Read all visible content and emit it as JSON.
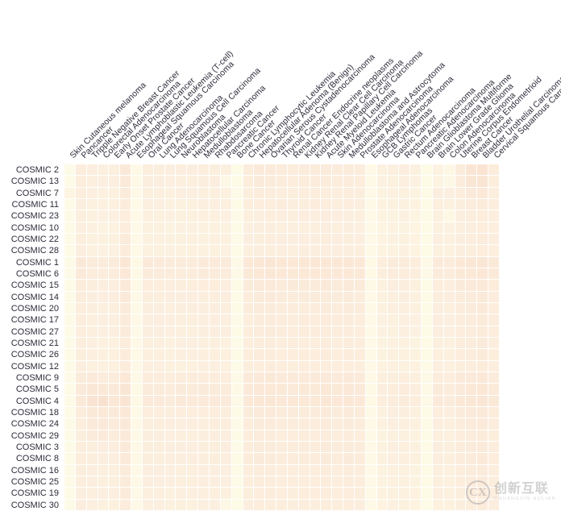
{
  "figure": {
    "type": "heatmap",
    "title": "",
    "watermark": {
      "logo_letter": "CX",
      "cn": "创新互联",
      "pinyin": "CHUANGXIN HULIAN"
    }
  },
  "chart_data": {
    "type": "heatmap",
    "title": "",
    "xlabel": "",
    "ylabel": "",
    "grid": true,
    "legend": "none",
    "colormap": {
      "low": "#fdfbe8",
      "mid": "#f8e2d2",
      "high": "#e8a896"
    },
    "x_tick_labels": [
      "Skin Cutaneous melanoma",
      "Pancancer",
      "Tripple Negative Breast Cancer",
      "Colorectal Adenocarcinoma",
      "Early Onset Prostate Cancer",
      "Acute Lymphoblastic Leukemia (T-cell)",
      "Esophageal Squamous Carcinoma",
      "Oral Cancer",
      "Lung Adenocarcinoma",
      "Lung Squamous Cell Carcinoma",
      "Neuroblastoma",
      "Hepatocellular Carcinoma",
      "Medulloblastoma",
      "Rhabdosarcoma",
      "Pancreatic Cancer",
      "Bone Cancer",
      "Chronic Lymphocytic Leukemia",
      "Hepatocellular Adenoma (Benign)",
      "Ovarian Serous Cystadenocarcinoma",
      "Thyroid Cancer",
      "Renal Cancer Endocrine neoplasms",
      "Kidney Renal Clear Cell Carcinoma",
      "Kidney Renal Papillary Cell Carcinoma",
      "Acute Myeloid Leukemia",
      "Skin Adenocarcinoma",
      "Medulloblastoma and Astrocytoma",
      "Prostate Adenocarcinoma",
      "Esophageal Adenocarcinoma",
      "GCB Lymphomas",
      "Gastric Cancer",
      "Rectum Adenocarcinoma",
      "Pancreatic Adenocarcinoma",
      "Brain Glioblastoma Multiforme",
      "Brain Lower Grade Glioma",
      "Colon Adenocarcinoma",
      "Uterine Corpus Endometrioid",
      "Breast Cancer",
      "Bladder Urothelial Carcinoma",
      "Cervical Squamous Carcinoma"
    ],
    "y_tick_labels": [
      "COSMIC 2",
      "COSMIC 13",
      "COSMIC 7",
      "COSMIC 11",
      "COSMIC 23",
      "COSMIC 10",
      "COSMIC 22",
      "COSMIC 28",
      "COSMIC 1",
      "COSMIC 6",
      "COSMIC 15",
      "COSMIC 14",
      "COSMIC 20",
      "COSMIC 17",
      "COSMIC 27",
      "COSMIC 21",
      "COSMIC 26",
      "COSMIC 12",
      "COSMIC 9",
      "COSMIC 5",
      "COSMIC 4",
      "COSMIC 18",
      "COSMIC 24",
      "COSMIC 29",
      "COSMIC 3",
      "COSMIC 8",
      "COSMIC 16",
      "COSMIC 25",
      "COSMIC 19",
      "COSMIC 30"
    ],
    "values": [
      [
        0.02,
        0.4,
        0.34,
        0.33,
        0.33,
        0.46,
        0.08,
        0.36,
        0.36,
        0.34,
        0.35,
        0.34,
        0.36,
        0.36,
        0.33,
        0.05,
        0.4,
        0.43,
        0.44,
        0.42,
        0.4,
        0.41,
        0.41,
        0.42,
        0.41,
        0.42,
        0.4,
        0.07,
        0.3,
        0.33,
        0.34,
        0.3,
        0.05,
        0.26,
        0.12,
        0.42,
        0.55,
        0.56,
        0.4
      ],
      [
        0.02,
        0.38,
        0.33,
        0.32,
        0.32,
        0.44,
        0.07,
        0.34,
        0.34,
        0.32,
        0.33,
        0.33,
        0.35,
        0.34,
        0.1,
        0.05,
        0.38,
        0.41,
        0.42,
        0.4,
        0.38,
        0.39,
        0.39,
        0.4,
        0.39,
        0.4,
        0.38,
        0.07,
        0.28,
        0.31,
        0.32,
        0.28,
        0.05,
        0.24,
        0.1,
        0.4,
        0.52,
        0.54,
        0.38
      ],
      [
        0.22,
        0.36,
        0.32,
        0.31,
        0.31,
        0.42,
        0.07,
        0.33,
        0.33,
        0.31,
        0.32,
        0.32,
        0.33,
        0.33,
        0.31,
        0.05,
        0.36,
        0.39,
        0.4,
        0.38,
        0.36,
        0.37,
        0.37,
        0.38,
        0.37,
        0.38,
        0.36,
        0.07,
        0.27,
        0.3,
        0.31,
        0.27,
        0.05,
        0.34,
        0.32,
        0.38,
        0.45,
        0.47,
        0.36
      ],
      [
        0.02,
        0.35,
        0.31,
        0.3,
        0.3,
        0.4,
        0.07,
        0.32,
        0.32,
        0.3,
        0.31,
        0.31,
        0.32,
        0.32,
        0.3,
        0.05,
        0.38,
        0.37,
        0.38,
        0.4,
        0.35,
        0.36,
        0.4,
        0.37,
        0.36,
        0.37,
        0.35,
        0.07,
        0.26,
        0.29,
        0.3,
        0.26,
        0.05,
        0.33,
        0.31,
        0.36,
        0.4,
        0.42,
        0.35
      ],
      [
        0.02,
        0.33,
        0.29,
        0.28,
        0.28,
        0.38,
        0.06,
        0.3,
        0.3,
        0.28,
        0.29,
        0.29,
        0.3,
        0.3,
        0.28,
        0.05,
        0.33,
        0.35,
        0.36,
        0.34,
        0.33,
        0.34,
        0.34,
        0.35,
        0.34,
        0.35,
        0.33,
        0.06,
        0.24,
        0.27,
        0.28,
        0.24,
        0.05,
        0.31,
        0.12,
        0.34,
        0.36,
        0.38,
        0.33
      ],
      [
        0.02,
        0.32,
        0.28,
        0.27,
        0.27,
        0.37,
        0.06,
        0.29,
        0.29,
        0.27,
        0.28,
        0.28,
        0.29,
        0.29,
        0.27,
        0.05,
        0.32,
        0.34,
        0.35,
        0.33,
        0.32,
        0.33,
        0.33,
        0.34,
        0.33,
        0.34,
        0.32,
        0.06,
        0.23,
        0.26,
        0.27,
        0.23,
        0.05,
        0.3,
        0.28,
        0.33,
        0.35,
        0.37,
        0.32
      ],
      [
        0.02,
        0.36,
        0.3,
        0.29,
        0.29,
        0.42,
        0.06,
        0.31,
        0.31,
        0.29,
        0.3,
        0.3,
        0.31,
        0.31,
        0.29,
        0.05,
        0.34,
        0.36,
        0.37,
        0.35,
        0.34,
        0.35,
        0.35,
        0.36,
        0.35,
        0.36,
        0.34,
        0.06,
        0.25,
        0.28,
        0.29,
        0.25,
        0.05,
        0.32,
        0.3,
        0.35,
        0.37,
        0.39,
        0.34
      ],
      [
        0.02,
        0.34,
        0.29,
        0.28,
        0.28,
        0.4,
        0.06,
        0.3,
        0.3,
        0.28,
        0.29,
        0.29,
        0.3,
        0.3,
        0.28,
        0.05,
        0.33,
        0.35,
        0.36,
        0.34,
        0.33,
        0.34,
        0.34,
        0.35,
        0.34,
        0.35,
        0.33,
        0.06,
        0.24,
        0.27,
        0.28,
        0.24,
        0.05,
        0.31,
        0.29,
        0.34,
        0.36,
        0.38,
        0.33
      ],
      [
        0.02,
        0.46,
        0.42,
        0.41,
        0.41,
        0.5,
        0.08,
        0.43,
        0.43,
        0.41,
        0.42,
        0.42,
        0.43,
        0.43,
        0.41,
        0.06,
        0.48,
        0.5,
        0.52,
        0.5,
        0.48,
        0.49,
        0.49,
        0.5,
        0.49,
        0.5,
        0.48,
        0.08,
        0.38,
        0.41,
        0.42,
        0.38,
        0.06,
        0.44,
        0.42,
        0.48,
        0.5,
        0.52,
        0.46
      ],
      [
        0.02,
        0.44,
        0.4,
        0.39,
        0.39,
        0.48,
        0.08,
        0.41,
        0.41,
        0.39,
        0.4,
        0.4,
        0.41,
        0.41,
        0.39,
        0.06,
        0.46,
        0.48,
        0.5,
        0.48,
        0.46,
        0.47,
        0.47,
        0.48,
        0.47,
        0.48,
        0.46,
        0.08,
        0.36,
        0.39,
        0.4,
        0.36,
        0.06,
        0.42,
        0.4,
        0.46,
        0.48,
        0.5,
        0.44
      ],
      [
        0.02,
        0.4,
        0.36,
        0.35,
        0.35,
        0.44,
        0.07,
        0.37,
        0.37,
        0.35,
        0.36,
        0.36,
        0.37,
        0.37,
        0.35,
        0.05,
        0.41,
        0.43,
        0.44,
        0.42,
        0.41,
        0.42,
        0.42,
        0.43,
        0.42,
        0.43,
        0.41,
        0.07,
        0.31,
        0.34,
        0.35,
        0.31,
        0.05,
        0.37,
        0.35,
        0.41,
        0.43,
        0.45,
        0.4
      ],
      [
        0.02,
        0.39,
        0.35,
        0.34,
        0.34,
        0.43,
        0.07,
        0.36,
        0.36,
        0.34,
        0.35,
        0.35,
        0.36,
        0.36,
        0.34,
        0.05,
        0.4,
        0.42,
        0.43,
        0.41,
        0.4,
        0.41,
        0.41,
        0.42,
        0.41,
        0.42,
        0.4,
        0.07,
        0.3,
        0.33,
        0.34,
        0.3,
        0.05,
        0.36,
        0.34,
        0.4,
        0.42,
        0.44,
        0.39
      ],
      [
        0.02,
        0.38,
        0.34,
        0.33,
        0.33,
        0.42,
        0.07,
        0.35,
        0.35,
        0.33,
        0.34,
        0.34,
        0.35,
        0.35,
        0.33,
        0.05,
        0.39,
        0.41,
        0.42,
        0.4,
        0.39,
        0.4,
        0.4,
        0.41,
        0.4,
        0.41,
        0.39,
        0.07,
        0.29,
        0.32,
        0.33,
        0.29,
        0.05,
        0.35,
        0.33,
        0.39,
        0.41,
        0.43,
        0.38
      ],
      [
        0.02,
        0.37,
        0.33,
        0.32,
        0.32,
        0.41,
        0.07,
        0.34,
        0.34,
        0.32,
        0.33,
        0.33,
        0.34,
        0.34,
        0.32,
        0.05,
        0.38,
        0.4,
        0.41,
        0.39,
        0.38,
        0.39,
        0.39,
        0.4,
        0.39,
        0.4,
        0.38,
        0.07,
        0.28,
        0.31,
        0.32,
        0.28,
        0.05,
        0.34,
        0.32,
        0.38,
        0.4,
        0.42,
        0.37
      ],
      [
        0.02,
        0.37,
        0.33,
        0.32,
        0.32,
        0.41,
        0.07,
        0.34,
        0.34,
        0.32,
        0.33,
        0.33,
        0.34,
        0.34,
        0.32,
        0.05,
        0.38,
        0.4,
        0.41,
        0.39,
        0.38,
        0.39,
        0.39,
        0.4,
        0.39,
        0.4,
        0.38,
        0.07,
        0.28,
        0.31,
        0.32,
        0.28,
        0.05,
        0.34,
        0.32,
        0.38,
        0.4,
        0.42,
        0.37
      ],
      [
        0.02,
        0.36,
        0.32,
        0.31,
        0.31,
        0.4,
        0.07,
        0.33,
        0.33,
        0.31,
        0.32,
        0.32,
        0.33,
        0.33,
        0.31,
        0.05,
        0.37,
        0.39,
        0.4,
        0.38,
        0.37,
        0.38,
        0.38,
        0.39,
        0.38,
        0.39,
        0.37,
        0.07,
        0.27,
        0.3,
        0.31,
        0.27,
        0.05,
        0.33,
        0.31,
        0.37,
        0.39,
        0.41,
        0.36
      ],
      [
        0.02,
        0.36,
        0.32,
        0.31,
        0.31,
        0.4,
        0.07,
        0.33,
        0.33,
        0.31,
        0.32,
        0.32,
        0.33,
        0.33,
        0.31,
        0.05,
        0.37,
        0.39,
        0.4,
        0.38,
        0.37,
        0.38,
        0.38,
        0.39,
        0.38,
        0.39,
        0.37,
        0.07,
        0.27,
        0.3,
        0.31,
        0.27,
        0.05,
        0.33,
        0.31,
        0.37,
        0.39,
        0.41,
        0.36
      ],
      [
        0.02,
        0.35,
        0.31,
        0.3,
        0.3,
        0.39,
        0.06,
        0.32,
        0.32,
        0.3,
        0.31,
        0.31,
        0.32,
        0.32,
        0.3,
        0.05,
        0.36,
        0.38,
        0.39,
        0.37,
        0.36,
        0.37,
        0.37,
        0.38,
        0.37,
        0.38,
        0.36,
        0.06,
        0.26,
        0.29,
        0.3,
        0.26,
        0.05,
        0.32,
        0.3,
        0.36,
        0.38,
        0.4,
        0.35
      ],
      [
        0.02,
        0.42,
        0.45,
        0.4,
        0.4,
        0.48,
        0.07,
        0.4,
        0.4,
        0.38,
        0.39,
        0.39,
        0.4,
        0.4,
        0.38,
        0.06,
        0.43,
        0.45,
        0.46,
        0.44,
        0.43,
        0.44,
        0.44,
        0.45,
        0.44,
        0.45,
        0.43,
        0.07,
        0.33,
        0.36,
        0.37,
        0.33,
        0.06,
        0.39,
        0.37,
        0.43,
        0.45,
        0.47,
        0.42
      ],
      [
        0.02,
        0.44,
        0.5,
        0.46,
        0.44,
        0.52,
        0.08,
        0.42,
        0.42,
        0.4,
        0.41,
        0.41,
        0.42,
        0.42,
        0.4,
        0.06,
        0.45,
        0.47,
        0.48,
        0.46,
        0.45,
        0.46,
        0.46,
        0.47,
        0.46,
        0.47,
        0.45,
        0.08,
        0.35,
        0.38,
        0.39,
        0.35,
        0.06,
        0.41,
        0.39,
        0.45,
        0.47,
        0.49,
        0.44
      ],
      [
        0.02,
        0.46,
        0.56,
        0.58,
        0.5,
        0.54,
        0.08,
        0.44,
        0.44,
        0.42,
        0.43,
        0.43,
        0.44,
        0.44,
        0.42,
        0.06,
        0.47,
        0.49,
        0.5,
        0.48,
        0.47,
        0.48,
        0.48,
        0.49,
        0.48,
        0.49,
        0.47,
        0.08,
        0.37,
        0.4,
        0.41,
        0.37,
        0.06,
        0.43,
        0.41,
        0.47,
        0.49,
        0.51,
        0.46
      ],
      [
        0.02,
        0.4,
        0.46,
        0.48,
        0.44,
        0.48,
        0.07,
        0.38,
        0.38,
        0.36,
        0.37,
        0.37,
        0.38,
        0.38,
        0.36,
        0.05,
        0.41,
        0.43,
        0.44,
        0.42,
        0.41,
        0.42,
        0.42,
        0.43,
        0.42,
        0.43,
        0.41,
        0.07,
        0.31,
        0.34,
        0.35,
        0.31,
        0.05,
        0.37,
        0.35,
        0.41,
        0.43,
        0.45,
        0.4
      ],
      [
        0.02,
        0.38,
        0.44,
        0.46,
        0.42,
        0.46,
        0.07,
        0.36,
        0.36,
        0.34,
        0.35,
        0.35,
        0.36,
        0.36,
        0.34,
        0.05,
        0.39,
        0.41,
        0.42,
        0.4,
        0.39,
        0.4,
        0.4,
        0.41,
        0.4,
        0.41,
        0.39,
        0.07,
        0.29,
        0.32,
        0.33,
        0.29,
        0.05,
        0.35,
        0.33,
        0.39,
        0.41,
        0.43,
        0.38
      ],
      [
        0.02,
        0.36,
        0.42,
        0.44,
        0.4,
        0.44,
        0.07,
        0.34,
        0.34,
        0.32,
        0.33,
        0.33,
        0.34,
        0.34,
        0.32,
        0.05,
        0.37,
        0.39,
        0.4,
        0.38,
        0.37,
        0.38,
        0.38,
        0.39,
        0.38,
        0.39,
        0.37,
        0.07,
        0.27,
        0.3,
        0.31,
        0.27,
        0.05,
        0.33,
        0.31,
        0.37,
        0.39,
        0.41,
        0.36
      ],
      [
        0.02,
        0.38,
        0.36,
        0.35,
        0.35,
        0.44,
        0.07,
        0.36,
        0.36,
        0.34,
        0.35,
        0.35,
        0.36,
        0.36,
        0.34,
        0.05,
        0.39,
        0.41,
        0.42,
        0.4,
        0.39,
        0.4,
        0.4,
        0.41,
        0.4,
        0.41,
        0.39,
        0.07,
        0.29,
        0.32,
        0.33,
        0.29,
        0.05,
        0.35,
        0.33,
        0.39,
        0.41,
        0.43,
        0.38
      ],
      [
        0.02,
        0.38,
        0.36,
        0.35,
        0.35,
        0.44,
        0.07,
        0.36,
        0.36,
        0.34,
        0.35,
        0.35,
        0.36,
        0.36,
        0.34,
        0.05,
        0.39,
        0.41,
        0.42,
        0.4,
        0.39,
        0.4,
        0.4,
        0.41,
        0.4,
        0.41,
        0.39,
        0.07,
        0.29,
        0.32,
        0.33,
        0.29,
        0.05,
        0.35,
        0.33,
        0.39,
        0.41,
        0.43,
        0.38
      ],
      [
        0.02,
        0.36,
        0.34,
        0.33,
        0.33,
        0.42,
        0.07,
        0.34,
        0.34,
        0.32,
        0.33,
        0.33,
        0.34,
        0.34,
        0.32,
        0.05,
        0.37,
        0.39,
        0.4,
        0.38,
        0.37,
        0.38,
        0.38,
        0.39,
        0.38,
        0.39,
        0.37,
        0.07,
        0.27,
        0.3,
        0.31,
        0.27,
        0.05,
        0.33,
        0.31,
        0.37,
        0.39,
        0.41,
        0.36
      ],
      [
        0.02,
        0.36,
        0.34,
        0.33,
        0.33,
        0.42,
        0.07,
        0.34,
        0.34,
        0.32,
        0.33,
        0.33,
        0.34,
        0.34,
        0.32,
        0.05,
        0.37,
        0.39,
        0.4,
        0.38,
        0.37,
        0.38,
        0.38,
        0.39,
        0.38,
        0.39,
        0.37,
        0.07,
        0.27,
        0.3,
        0.31,
        0.27,
        0.05,
        0.33,
        0.31,
        0.37,
        0.39,
        0.41,
        0.36
      ],
      [
        0.02,
        0.35,
        0.33,
        0.32,
        0.32,
        0.41,
        0.07,
        0.33,
        0.33,
        0.31,
        0.32,
        0.32,
        0.33,
        0.33,
        0.31,
        0.05,
        0.36,
        0.38,
        0.39,
        0.37,
        0.36,
        0.37,
        0.37,
        0.38,
        0.37,
        0.38,
        0.36,
        0.07,
        0.26,
        0.29,
        0.3,
        0.26,
        0.05,
        0.32,
        0.3,
        0.36,
        0.38,
        0.4,
        0.35
      ],
      [
        0.02,
        0.34,
        0.32,
        0.31,
        0.31,
        0.4,
        0.06,
        0.32,
        0.32,
        0.3,
        0.31,
        0.31,
        0.32,
        0.32,
        0.1,
        0.05,
        0.35,
        0.37,
        0.38,
        0.36,
        0.35,
        0.36,
        0.36,
        0.37,
        0.36,
        0.37,
        0.35,
        0.06,
        0.25,
        0.28,
        0.29,
        0.25,
        0.05,
        0.31,
        0.29,
        0.35,
        0.37,
        0.39,
        0.34
      ]
    ]
  }
}
